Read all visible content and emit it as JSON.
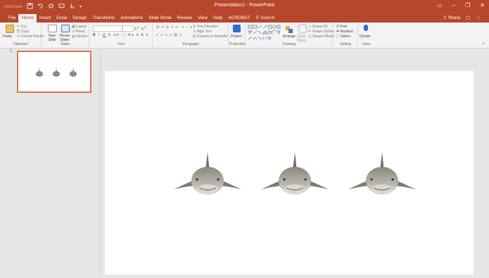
{
  "qat": {
    "autosave_label": "AutoSave",
    "save_icon": "save-icon",
    "undo_icon": "undo-icon",
    "redo_icon": "redo-icon",
    "customize_icon": "chevron-down-icon"
  },
  "window": {
    "title": "Presentation1 - PowerPoint"
  },
  "tabs": [
    {
      "label": "File"
    },
    {
      "label": "Home"
    },
    {
      "label": "Insert"
    },
    {
      "label": "Draw"
    },
    {
      "label": "Design"
    },
    {
      "label": "Transitions"
    },
    {
      "label": "Animations"
    },
    {
      "label": "Slide Show"
    },
    {
      "label": "Review"
    },
    {
      "label": "View"
    },
    {
      "label": "Help"
    },
    {
      "label": "ACROBAT"
    }
  ],
  "tell_me": "Search",
  "share": {
    "label": "Share"
  },
  "ribbon": {
    "clipboard": {
      "label": "Clipboard",
      "paste": "Paste",
      "cut": "Cut",
      "copy": "Copy",
      "format_painter": "Format Painter"
    },
    "slides": {
      "label": "Slides",
      "new_slide": "New Slide",
      "reuse_slides": "Reuse Slides",
      "layout": "Layout",
      "reset": "Reset",
      "section": "Section"
    },
    "font": {
      "label": "Font"
    },
    "paragraph": {
      "label": "Paragraph",
      "text_direction": "Text Direction",
      "align_text": "Align Text",
      "convert_smartart": "Convert to SmartArt"
    },
    "protection": {
      "label": "Protection",
      "protect": "Protect"
    },
    "drawing": {
      "label": "Drawing",
      "arrange": "Arrange",
      "quick_styles": "Quick Styles",
      "shape_fill": "Shape Fill",
      "shape_outline": "Shape Outline",
      "shape_effects": "Shape Effects"
    },
    "editing": {
      "label": "Editing",
      "find": "Find",
      "replace": "Replace",
      "select": "Select"
    },
    "voice": {
      "label": "Voice",
      "dictate": "Dictate"
    }
  },
  "slides_pane": {
    "slide_number": "1"
  },
  "colors": {
    "accent": "#b7472a",
    "thumb_border": "#d9774f"
  }
}
